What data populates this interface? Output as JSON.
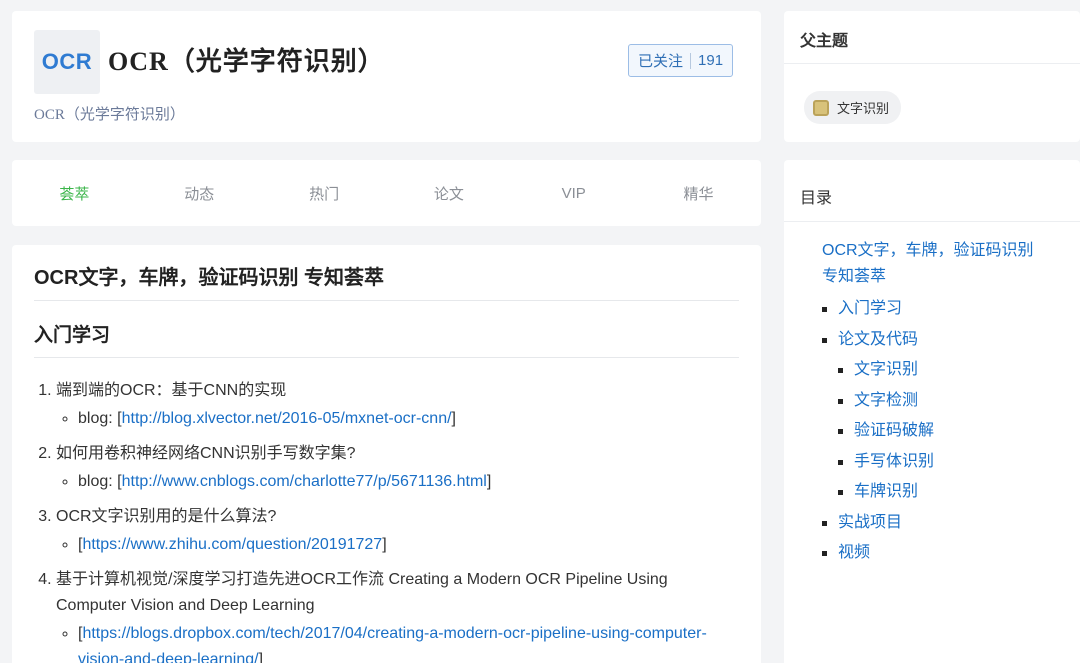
{
  "header": {
    "logo_text": "OCR",
    "title": "OCR（光学字符识别）",
    "subtitle": "OCR（光学字符识别）",
    "follow_label": "已关注",
    "follow_count": "191"
  },
  "tabs": [
    {
      "label": "荟萃",
      "active": true
    },
    {
      "label": "动态"
    },
    {
      "label": "热门"
    },
    {
      "label": "论文"
    },
    {
      "label": "VIP"
    },
    {
      "label": "精华"
    }
  ],
  "article": {
    "title": "OCR文字，车牌，验证码识别 专知荟萃",
    "section": "入门学习",
    "items": [
      {
        "text": "端到端的OCR：基于CNN的实现",
        "sub_prefix": "blog: [",
        "link": "http://blog.xlvector.net/2016-05/mxnet-ocr-cnn/",
        "sub_suffix": "]"
      },
      {
        "text": "如何用卷积神经网络CNN识别手写数字集?",
        "sub_prefix": "blog: [",
        "link": "http://www.cnblogs.com/charlotte77/p/5671136.html",
        "sub_suffix": "]"
      },
      {
        "text": "OCR文字识别用的是什么算法?",
        "sub_prefix": "[",
        "link": "https://www.zhihu.com/question/20191727",
        "sub_suffix": "]"
      },
      {
        "text": "基于计算机视觉/深度学习打造先进OCR工作流 Creating a Modern OCR Pipeline Using Computer Vision and Deep Learning",
        "sub_prefix": "[",
        "link": "https://blogs.dropbox.com/tech/2017/04/creating-a-modern-ocr-pipeline-using-computer-vision-and-deep-learning/",
        "sub_suffix": "]"
      }
    ]
  },
  "sidebar": {
    "parent_heading": "父主题",
    "parent_tag": "文字识别",
    "toc_heading": "目录",
    "toc_top": "OCR文字，车牌，验证码识别 专知荟萃",
    "toc": [
      {
        "label": "入门学习"
      },
      {
        "label": "论文及代码",
        "children": [
          "文字识别",
          "文字检测",
          "验证码破解",
          "手写体识别",
          "车牌识别"
        ]
      },
      {
        "label": "实战项目"
      },
      {
        "label": "视频"
      }
    ]
  }
}
